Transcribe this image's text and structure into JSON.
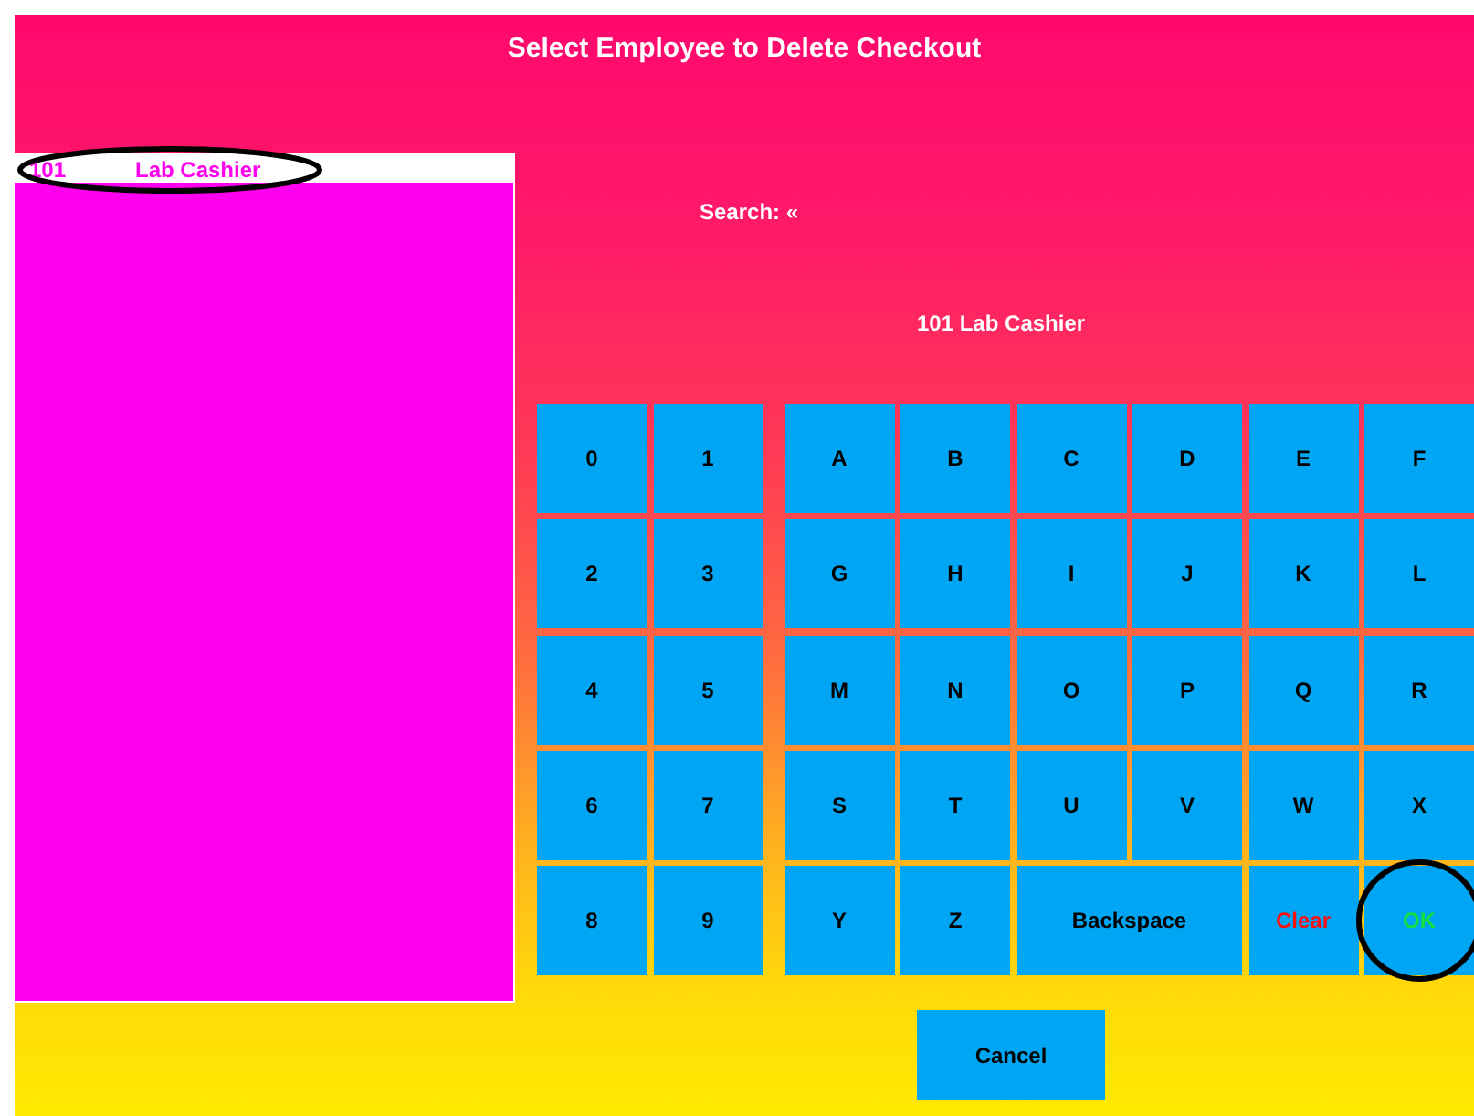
{
  "title": "Select Employee to Delete Checkout",
  "employees": [
    {
      "number": "101",
      "name": "Lab Cashier",
      "selected": true,
      "highlight": true
    }
  ],
  "search": {
    "label": "Search: «"
  },
  "current_employee": "101 Lab Cashier",
  "digit_keys": [
    {
      "label": "0"
    },
    {
      "label": "1"
    },
    {
      "label": "2"
    },
    {
      "label": "3"
    },
    {
      "label": "4"
    },
    {
      "label": "5"
    },
    {
      "label": "6"
    },
    {
      "label": "7"
    },
    {
      "label": "8"
    },
    {
      "label": "9"
    }
  ],
  "letter_keys": [
    {
      "label": "A",
      "kind": "char"
    },
    {
      "label": "B",
      "kind": "char"
    },
    {
      "label": "C",
      "kind": "char"
    },
    {
      "label": "D",
      "kind": "char"
    },
    {
      "label": "E",
      "kind": "char"
    },
    {
      "label": "F",
      "kind": "char"
    },
    {
      "label": "G",
      "kind": "char"
    },
    {
      "label": "H",
      "kind": "char"
    },
    {
      "label": "I",
      "kind": "char"
    },
    {
      "label": "J",
      "kind": "char"
    },
    {
      "label": "K",
      "kind": "char"
    },
    {
      "label": "L",
      "kind": "char"
    },
    {
      "label": "M",
      "kind": "char"
    },
    {
      "label": "N",
      "kind": "char"
    },
    {
      "label": "O",
      "kind": "char"
    },
    {
      "label": "P",
      "kind": "char"
    },
    {
      "label": "Q",
      "kind": "char"
    },
    {
      "label": "R",
      "kind": "char"
    },
    {
      "label": "S",
      "kind": "char"
    },
    {
      "label": "T",
      "kind": "char"
    },
    {
      "label": "U",
      "kind": "char"
    },
    {
      "label": "V",
      "kind": "char"
    },
    {
      "label": "W",
      "kind": "char"
    },
    {
      "label": "X",
      "kind": "char"
    },
    {
      "label": "Y",
      "kind": "char"
    },
    {
      "label": "Z",
      "kind": "char"
    },
    {
      "label": "Backspace",
      "kind": "backspace"
    },
    {
      "label": "Clear",
      "kind": "clear"
    },
    {
      "label": "OK",
      "kind": "ok",
      "highlight": true
    }
  ],
  "cancel": "Cancel"
}
